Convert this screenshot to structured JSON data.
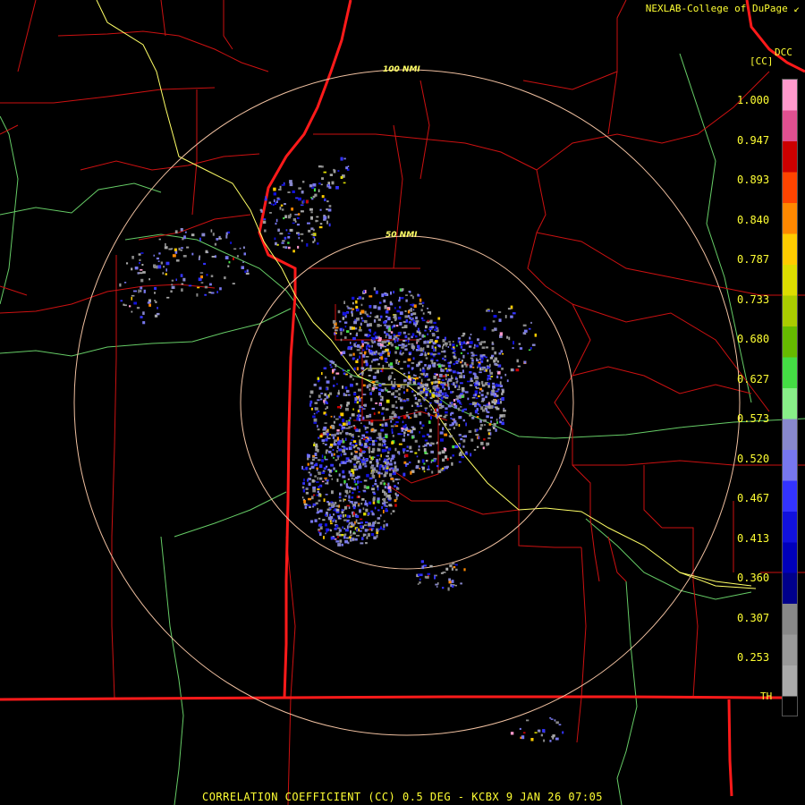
{
  "header": {
    "credit": "NEXLAB-College of DuPage",
    "credit_mark_icon": "corner-arrow-icon",
    "product_code": "[CC]",
    "product_short": "DCC"
  },
  "rings": [
    {
      "label": "100 NMI"
    },
    {
      "label": "50 NMI"
    }
  ],
  "legend": {
    "ticks": [
      "1.000",
      "0.947",
      "0.893",
      "0.840",
      "0.787",
      "0.733",
      "0.680",
      "0.627",
      "0.573",
      "0.520",
      "0.467",
      "0.413",
      "0.360",
      "0.307",
      "0.253"
    ],
    "threshold_label": "TH",
    "color_stops": [
      "#ff99cc",
      "#e05090",
      "#cc0000",
      "#ff4400",
      "#ff8800",
      "#ffcc00",
      "#dddd00",
      "#aacc00",
      "#66bb00",
      "#44dd44",
      "#88ee88",
      "#8888cc",
      "#7777ee",
      "#3333ff",
      "#1111dd",
      "#0000bb",
      "#00008b",
      "#888888",
      "#999999",
      "#aaaaaa"
    ]
  },
  "colors": {
    "county_lines": "#cc1111",
    "state_lines": "#ff1a1a",
    "highways": "#ffff66",
    "rivers": "#66cc66",
    "range_rings": "#f0c0a0"
  },
  "footer": {
    "caption": "CORRELATION COEFFICIENT (CC) 0.5 DEG - KCBX 9 JAN 26 07:05"
  }
}
